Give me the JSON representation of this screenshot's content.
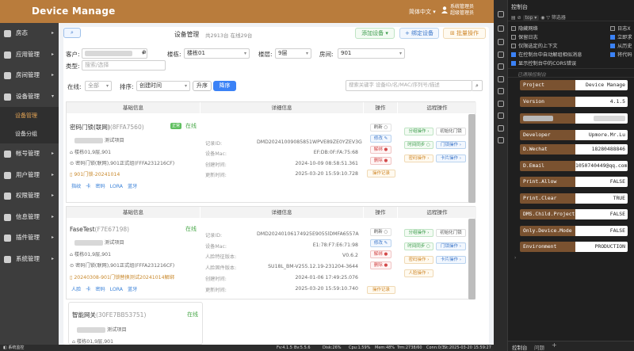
{
  "header": {
    "title": "Device Manage",
    "lang": "简体中文",
    "user_line1": "系统管理员",
    "user_line2": "超级管理员"
  },
  "sidebar": {
    "items": [
      {
        "label": "房态",
        "caret": "▸"
      },
      {
        "label": "应用管理",
        "caret": "▸"
      },
      {
        "label": "房间管理",
        "caret": "▸"
      },
      {
        "label": "设备管理",
        "caret": "▾"
      },
      {
        "label": "设备管理",
        "sub": true,
        "active": true
      },
      {
        "label": "设备分组",
        "sub": true
      },
      {
        "label": "帐号管理",
        "caret": "▸"
      },
      {
        "label": "用户管理",
        "caret": "▸"
      },
      {
        "label": "权限管理",
        "caret": "▸"
      },
      {
        "label": "信息管理",
        "caret": "▸"
      },
      {
        "label": "插件管理",
        "caret": "▸"
      },
      {
        "label": "系统管理",
        "caret": "▸"
      }
    ]
  },
  "page": {
    "title": "设备管理",
    "count_text": "共2913台 在线29台",
    "btn_add": "添加设备",
    "btn_bind": "+ 绑定设备",
    "btn_batch": "批量操作",
    "search_btn": "⌕"
  },
  "filters": {
    "customer_label": "客户:",
    "building_label": "楼栋:",
    "building_value": "楼栋01",
    "floor_label": "楼层:",
    "floor_value": "9层",
    "room_label": "房间:",
    "room_value": "901",
    "type_label": "类型:",
    "type_placeholder": "搜索/选择",
    "online_label": "在线:",
    "online_value": "全部",
    "sort_label": "排序:",
    "sort_value": "创建时间",
    "asc": "升序",
    "desc": "降序",
    "search_placeholder": "搜索关键字 设备ID/名/MAC/序列号/描述"
  },
  "table": {
    "col_basic": "基础信息",
    "col_detail": "详细信息",
    "col_ops": "操作",
    "col_remote": "远程操作"
  },
  "devices": [
    {
      "name": "密码门锁(联网)",
      "id_suffix": "(8FFA7560)",
      "tag": "正常",
      "online": "在线",
      "test_label": "测试项目",
      "loc": "楼栋01,9层,901",
      "guard": "密码门锁(联网),901正式组(FFFA231216CF)",
      "group": "901门锁-20241014",
      "actions": [
        "指纹",
        "卡",
        "密码",
        "LORA",
        "蓝牙"
      ],
      "d_id_label": "记录ID:",
      "d_id": "DMD20241009085851WPVE89ZE0YZEV3G",
      "d_mac_label": "设备Mac:",
      "d_mac": "EF:DB:0F:FA:75:68",
      "d_created_label": "创建时间:",
      "d_created": "2024-10-09 08:58:51.361",
      "d_updated_label": "更新时间:",
      "d_updated": "2025-03-20 15:59:10.728",
      "ops": [
        "刷新",
        "修改",
        "解绑",
        "删除",
        "操作记录"
      ],
      "remote": [
        "分组操作",
        "初始化门锁",
        "时间同步",
        "门锁操作",
        "密码操作",
        "卡片操作"
      ]
    },
    {
      "name": "FaseTest",
      "id_suffix": "(F7E67198)",
      "tag": "",
      "online": "在线",
      "test_label": "测试项目",
      "loc": "楼栋01,9层,901",
      "guard": "密码门锁(联网),901正式组(FFFA231216CF)",
      "group": "20240308-901门锁替换测试20241014解绑",
      "actions": [
        "人脸",
        "卡",
        "密码",
        "LORA",
        "蓝牙"
      ],
      "d_id_label": "记录ID:",
      "d_id": "DMD20240106174925E9055lDMFA6557A",
      "d_mac_label": "设备Mac:",
      "d_mac": "E1:78:F7:E6:71:98",
      "d_feat_label": "人脸特征版本:",
      "d_feat": "V0.6.2",
      "d_fw_label": "人脸固件版本:",
      "d_fw": "SU18L_BM-V255.12.19-231204-3644",
      "d_created_label": "创建时间:",
      "d_created": "2024-01-06 17:49:25.076",
      "d_updated_label": "更新时间:",
      "d_updated": "2025-03-20 15:59:10.740",
      "ops": [
        "刷新",
        "修改",
        "解绑",
        "删除",
        "操作记录"
      ],
      "remote": [
        "分组操作",
        "初始化门锁",
        "时间同步",
        "门锁操作",
        "密码操作",
        "卡片操作",
        "人脸操作"
      ]
    },
    {
      "name": "智能网关",
      "id_suffix": "(30FE7BB53751)",
      "online": "在线",
      "test_label": "测试项目",
      "loc": "楼栋01,9层,901"
    }
  ],
  "devtools": {
    "title": "控制台",
    "top": "top ▾",
    "filter": "筛选器",
    "checks": [
      [
        "隐藏网络",
        false
      ],
      [
        "日志X",
        false
      ],
      [
        "保留日志",
        false
      ],
      [
        "立即求",
        false
      ],
      [
        "仅限选定的上下文",
        false
      ],
      [
        "从历史",
        false
      ],
      [
        "在控制台中自动解组相似消息",
        true
      ],
      [
        "将代码",
        true
      ],
      [
        "显示控制台中的CORS错误",
        true
      ]
    ],
    "msg": "已清除控制台",
    "table": [
      [
        "Project",
        "Device Manage"
      ],
      [
        "Version",
        "4.1.5"
      ],
      [
        "",
        ""
      ],
      [
        "Developer",
        "Upmore.Mr.Lu"
      ],
      [
        "D.Wechat",
        "18280488846"
      ],
      [
        "D.Email",
        "1050740449@qq.com"
      ],
      [
        "Print.Allow",
        "FALSE"
      ],
      [
        "Print.Clear",
        "TRUE"
      ],
      [
        "DMS.Child.Project",
        "FALSE"
      ],
      [
        "Only.Device.Mode",
        "FALSE"
      ],
      [
        "Environment",
        "PRODUCTION"
      ]
    ],
    "footer_tab1": "控制台",
    "footer_tab2": "问题"
  },
  "status": {
    "left": "◧ 系统监控",
    "fv": "Fv:4.1.5",
    "bv": "Bv:5.5.6",
    "disk": "Disk:26%",
    "cpu": "Cpu:1.59%",
    "mem": "Mem:48%",
    "trm": "Trm:2738/60",
    "conn": "Conn:0/3",
    "time": "St:2025-03-20 15:59:27"
  }
}
